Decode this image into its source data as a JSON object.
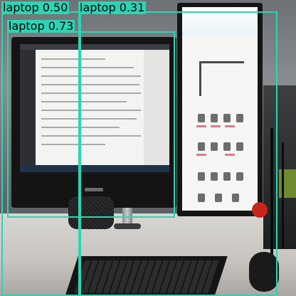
{
  "scene": {
    "description_tags": [
      "desk",
      "monitor-left",
      "monitor-right",
      "keyboard",
      "mouse"
    ]
  },
  "detections": [
    {
      "class": "laptop",
      "score": "0.50",
      "label": "laptop 0.50"
    },
    {
      "class": "laptop",
      "score": "0.31",
      "label": "laptop 0.31"
    },
    {
      "class": "laptop",
      "score": "0.73",
      "label": "laptop 0.73"
    }
  ],
  "colors": {
    "box": "#2dd4b4",
    "label_text": "#000000"
  }
}
